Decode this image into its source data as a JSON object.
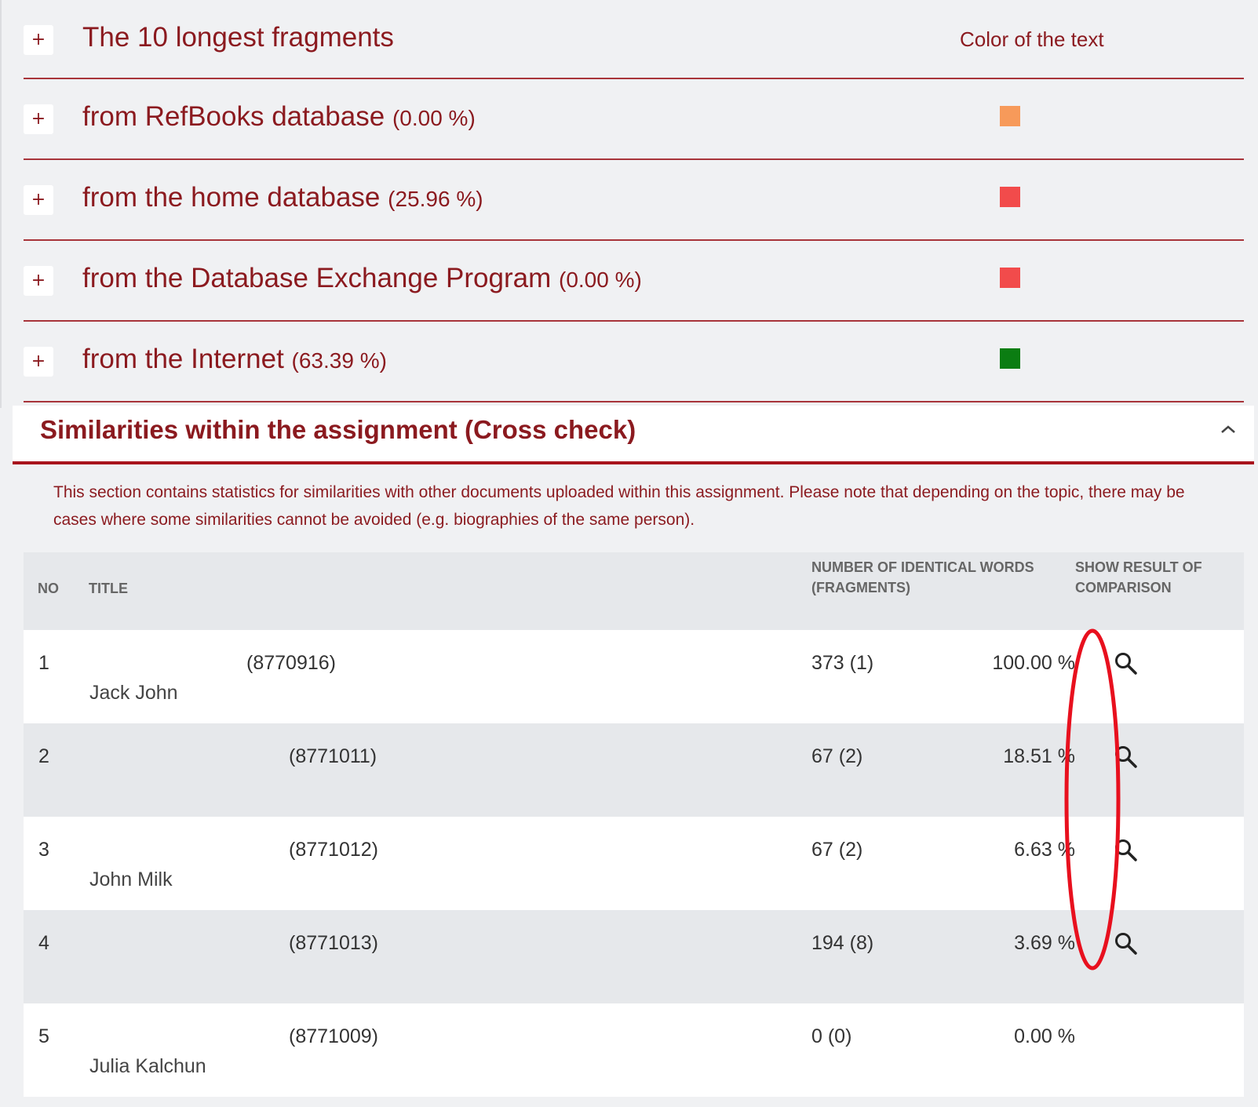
{
  "fragments": {
    "header_title": "The 10 longest fragments",
    "color_header": "Color of the text",
    "rows": [
      {
        "label": "from RefBooks database",
        "pct": "(0.00 %)",
        "color": "#f79a5a"
      },
      {
        "label": "from the home database",
        "pct": "(25.96 %)",
        "color": "#f24b4b"
      },
      {
        "label": "from the Database Exchange Program",
        "pct": "(0.00 %)",
        "color": "#f24b4b"
      },
      {
        "label": "from the Internet",
        "pct": "(63.39 %)",
        "color": "#0b7d12"
      }
    ],
    "expand_symbol": "+"
  },
  "cross_check": {
    "title": "Similarities within the assignment (Cross check)",
    "collapse_symbol": "^",
    "description": "This section contains statistics for similarities with other documents uploaded within this assignment. Please note that depending on the topic, there may be cases where some similarities cannot be avoided (e.g. biographies of the same person).",
    "columns": {
      "no": "NO",
      "title": "TITLE",
      "words": "NUMBER OF IDENTICAL WORDS (FRAGMENTS)",
      "show": "SHOW RESULT OF COMPARISON"
    },
    "rows": [
      {
        "no": "1",
        "id": "(8770916)",
        "author": "Jack John",
        "words": "373 (1)",
        "pct": "100.00 %",
        "has_compare": true
      },
      {
        "no": "2",
        "id": "(8771011)",
        "author": "",
        "words": "67 (2)",
        "pct": "18.51 %",
        "has_compare": true
      },
      {
        "no": "3",
        "id": "(8771012)",
        "author": "John Milk",
        "words": "67 (2)",
        "pct": "6.63 %",
        "has_compare": true
      },
      {
        "no": "4",
        "id": "(8771013)",
        "author": "",
        "words": "194 (8)",
        "pct": "3.69 %",
        "has_compare": true
      },
      {
        "no": "5",
        "id": "(8771009)",
        "author": "Julia Kalchun",
        "words": "0 (0)",
        "pct": "0.00 %",
        "has_compare": false
      }
    ]
  },
  "colors": {
    "brand_red": "#8b1a1f",
    "annotation_red": "#e8101e"
  },
  "icons": {
    "compare": "magnifier-search-icon"
  }
}
